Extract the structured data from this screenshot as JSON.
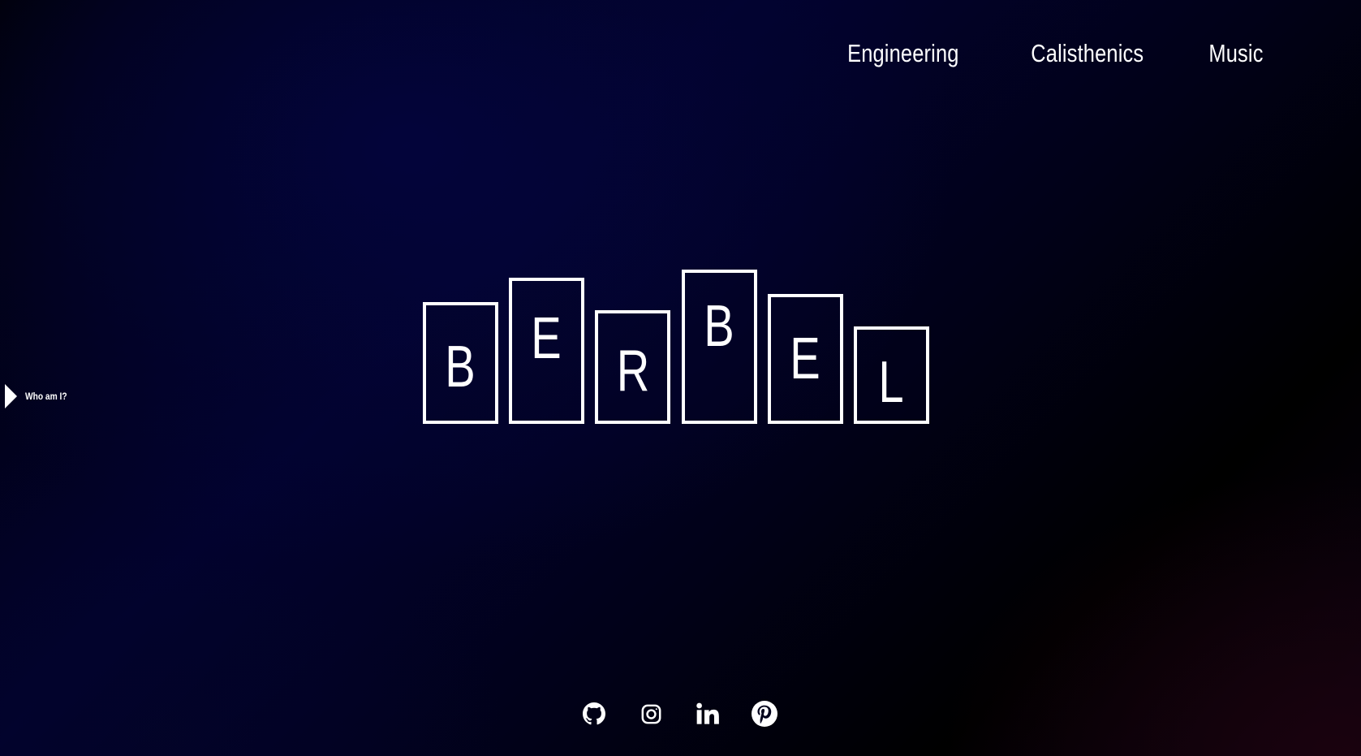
{
  "nav": {
    "items": [
      {
        "label": "Engineering"
      },
      {
        "label": "Calisthenics"
      },
      {
        "label": "Music"
      }
    ]
  },
  "side_tab": {
    "label": "Who am I?",
    "icon": "play-triangle-icon"
  },
  "logo": {
    "letters": [
      "B",
      "E",
      "R",
      "B",
      "E",
      "L"
    ]
  },
  "socials": [
    {
      "name": "GitHub",
      "icon": "github-icon"
    },
    {
      "name": "Instagram",
      "icon": "instagram-icon"
    },
    {
      "name": "LinkedIn",
      "icon": "linkedin-icon"
    },
    {
      "name": "Pinterest",
      "icon": "pinterest-icon"
    }
  ],
  "colors": {
    "foreground": "#ffffff",
    "background_deep_blue": "#020230",
    "background_black": "#000000"
  }
}
